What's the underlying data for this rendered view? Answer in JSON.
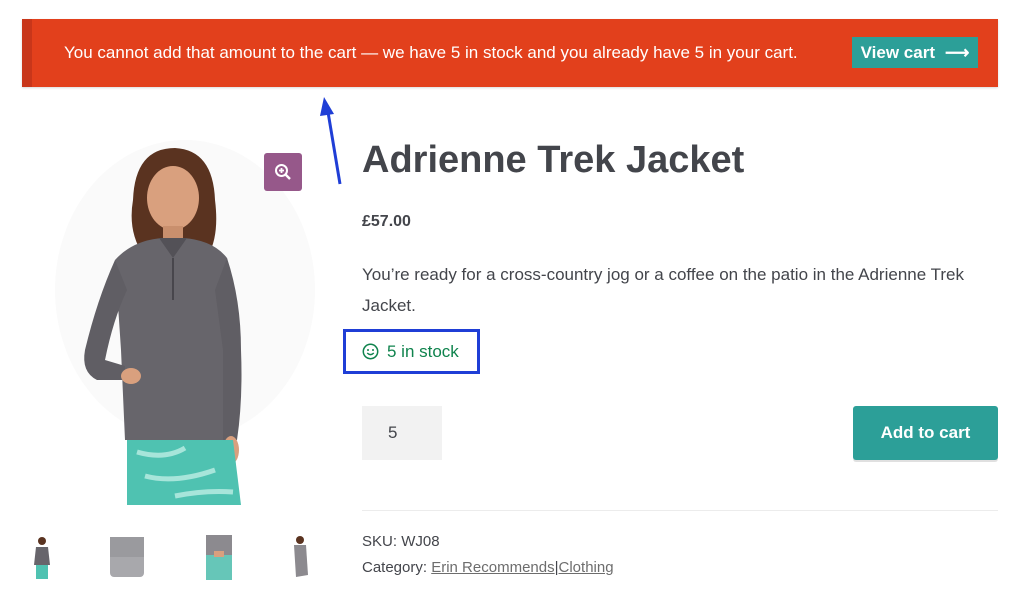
{
  "notice": {
    "message": "You cannot add that amount to the cart — we have 5 in stock and you already have 5 in your cart.",
    "button_label": "View cart",
    "arrow_glyph": "⟶"
  },
  "product": {
    "title": "Adrienne Trek Jacket",
    "price": "£57.00",
    "description": "You’re ready for a cross-country jog or a coffee on the patio in the Adrienne Trek Jacket.",
    "stock_text": "5 in stock",
    "quantity": "5",
    "add_to_cart_label": "Add to cart",
    "sku_label": "SKU:",
    "sku_value": "WJ08",
    "category_label": "Category:",
    "categories": [
      "Erin Recommends",
      "Clothing"
    ],
    "category_separator": "|"
  },
  "gallery": {
    "zoom_icon": "zoom-in-icon",
    "thumbnail_count": 4
  },
  "colors": {
    "notice_bg": "#e2401c",
    "button_teal": "#2c9f98",
    "zoom_purple": "#96588a",
    "stock_green": "#0f834d",
    "annotation_blue": "#1f3ed6"
  }
}
